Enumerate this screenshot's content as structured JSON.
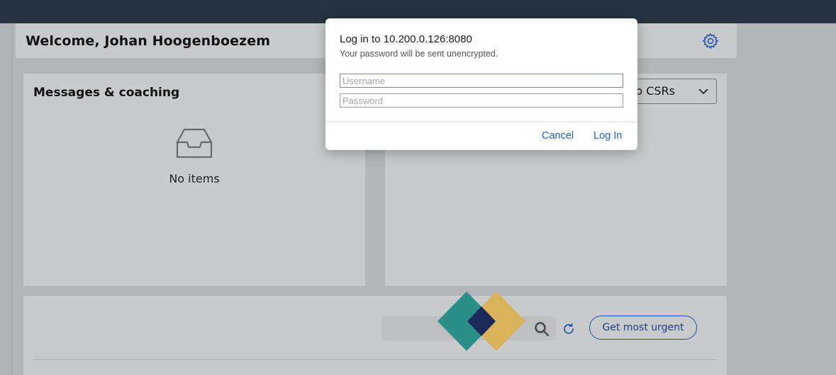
{
  "welcome": {
    "title": "Welcome, Johan Hoogenboezem"
  },
  "messages": {
    "title": "Messages & coaching",
    "empty_text": "No items"
  },
  "right_card": {
    "dropdown_label": "Top CSRs"
  },
  "work_queue": {
    "get_most_urgent_label": "Get most urgent"
  },
  "login_dialog": {
    "title": "Log in to 10.200.0.126:8080",
    "subtitle": "Your password will be sent unencrypted.",
    "username_placeholder": "Username",
    "password_placeholder": "Password",
    "cancel_label": "Cancel",
    "login_label": "Log In"
  },
  "icons": {
    "settings": "gear-icon",
    "inbox": "inbox-icon",
    "dropdown": "chevron-down-icon",
    "search": "search-icon",
    "refresh": "refresh-icon"
  },
  "colors": {
    "top_bar": "#263340",
    "accent_blue": "#1a62d6",
    "button_outline": "#1d4fa0",
    "loader_teal": "#2a8f86",
    "loader_gold": "#d9b25a",
    "loader_navy": "#1c2a5a"
  }
}
